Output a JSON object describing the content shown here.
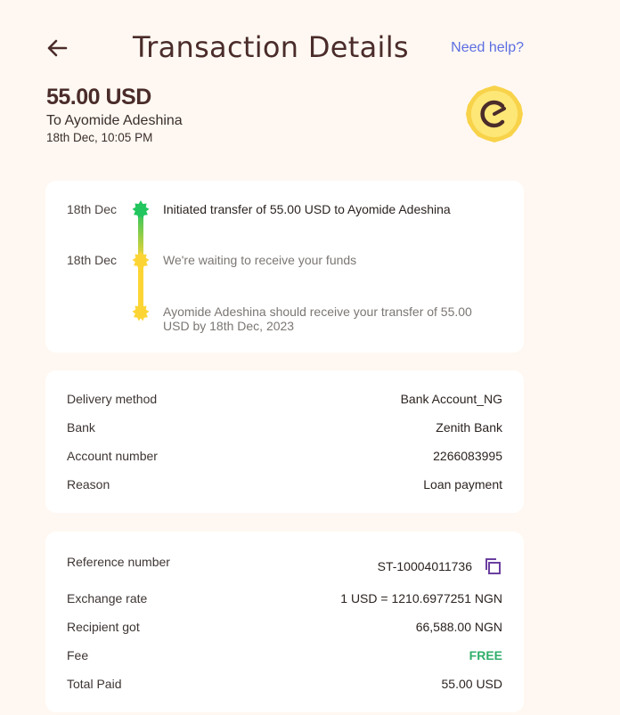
{
  "header": {
    "title": "Transaction Details",
    "help_link": "Need help?"
  },
  "summary": {
    "amount": "55.00 USD",
    "recipient": "To Ayomide Adeshina",
    "datetime": "18th Dec, 10:05 PM"
  },
  "timeline": [
    {
      "date": "18th Dec",
      "text": "Initiated transfer of 55.00 USD to Ayomide Adeshina",
      "status": "complete"
    },
    {
      "date": "18th Dec",
      "text": "We're waiting to receive your funds",
      "status": "pending"
    },
    {
      "date": "",
      "text": "Ayomide Adeshina should receive your transfer of 55.00 USD by 18th Dec, 2023",
      "status": "pending"
    }
  ],
  "delivery_details": [
    {
      "label": "Delivery method",
      "value": "Bank Account_NG"
    },
    {
      "label": "Bank",
      "value": "Zenith Bank"
    },
    {
      "label": "Account number",
      "value": "2266083995"
    },
    {
      "label": "Reason",
      "value": "Loan payment"
    }
  ],
  "payment_details": [
    {
      "label": "Reference number",
      "value": "ST-10004011736",
      "icon": "copy-icon"
    },
    {
      "label": "Exchange rate",
      "value": "1 USD = 1210.6977251 NGN"
    },
    {
      "label": "Recipient got",
      "value": "66,588.00 NGN"
    },
    {
      "label": "Fee",
      "value": "FREE"
    },
    {
      "label": "Total Paid",
      "value": "55.00 USD"
    }
  ],
  "colors": {
    "background": "#fff8f2",
    "title": "#4a2c2a",
    "link": "#5b6ee1",
    "complete": "#22c55e",
    "pending": "#fcd535",
    "free": "#2fae6a",
    "copy_icon": "#6b3fa0"
  }
}
